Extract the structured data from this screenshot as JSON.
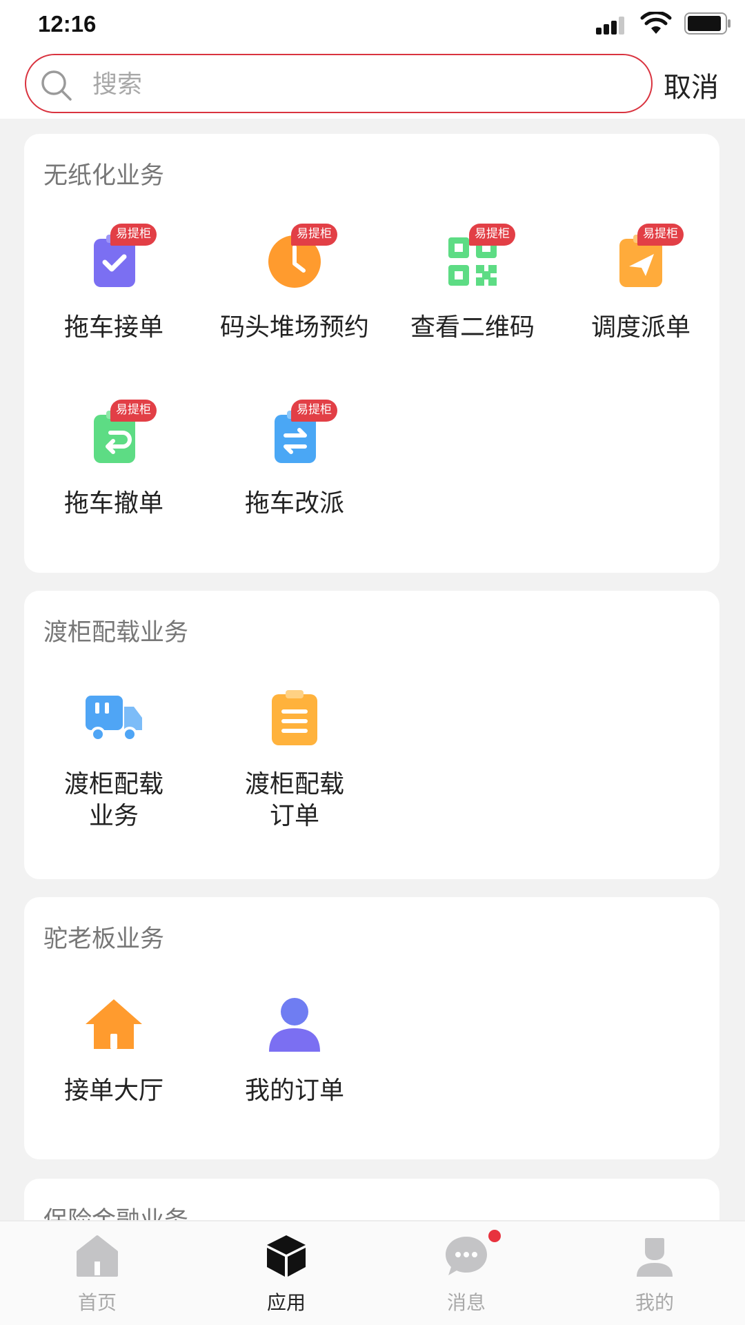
{
  "status_bar": {
    "time": "12:16"
  },
  "search": {
    "placeholder": "搜索",
    "cancel_label": "取消"
  },
  "badge_text": "易提柜",
  "sections": [
    {
      "title": "无纸化业务",
      "items": [
        {
          "label": "拖车接单",
          "icon": "clipboard-check-icon",
          "badge": true,
          "color": "#7b6ff2"
        },
        {
          "label": "码头堆场预约",
          "icon": "clock-icon",
          "badge": true,
          "color": "#ff9b2e"
        },
        {
          "label": "查看二维码",
          "icon": "qr-code-icon",
          "badge": true,
          "color": "#5ddc84"
        },
        {
          "label": "调度派单",
          "icon": "paper-plane-icon",
          "badge": true,
          "color": "#ffab3b"
        },
        {
          "label": "拖车撤单",
          "icon": "clipboard-undo-icon",
          "badge": true,
          "color": "#5ddc84"
        },
        {
          "label": "拖车改派",
          "icon": "clipboard-swap-icon",
          "badge": true,
          "color": "#4aa7f5"
        }
      ]
    },
    {
      "title": "渡柜配载业务",
      "items": [
        {
          "label": "渡柜配载\n业务",
          "icon": "truck-icon",
          "badge": false,
          "color": "#4fa5f5"
        },
        {
          "label": "渡柜配载\n订单",
          "icon": "clipboard-list-icon",
          "badge": false,
          "color": "#ffb23c"
        }
      ]
    },
    {
      "title": "驼老板业务",
      "items": [
        {
          "label": "接单大厅",
          "icon": "house-icon",
          "badge": false,
          "color": "#ff9b2e"
        },
        {
          "label": "我的订单",
          "icon": "person-icon",
          "badge": false,
          "color": "#7b6ff2"
        }
      ]
    },
    {
      "title": "保险金融业务",
      "items": []
    }
  ],
  "tab_bar": {
    "tabs": [
      {
        "label": "首页",
        "icon": "home-icon",
        "active": false
      },
      {
        "label": "应用",
        "icon": "cube-icon",
        "active": true
      },
      {
        "label": "消息",
        "icon": "chat-bubble-icon",
        "active": false,
        "unread_dot": true
      },
      {
        "label": "我的",
        "icon": "profile-icon",
        "active": false
      }
    ]
  }
}
